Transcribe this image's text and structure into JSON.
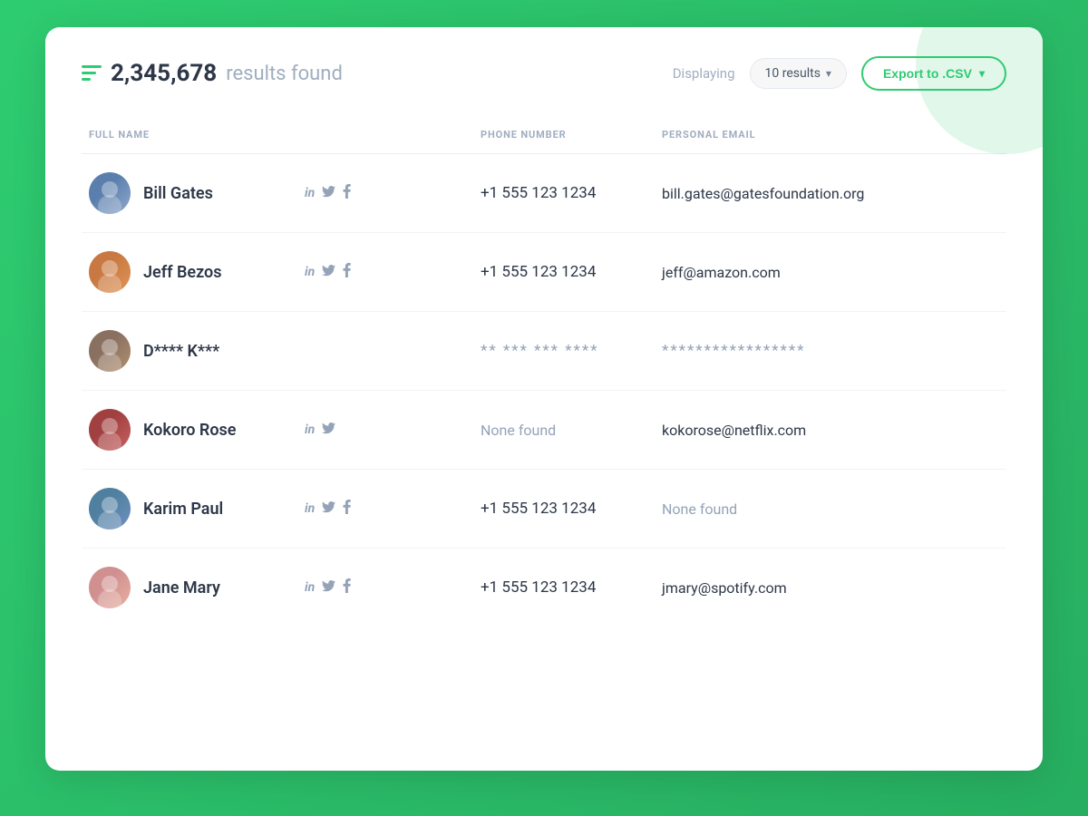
{
  "header": {
    "filter_icon": "≡",
    "results_count": "2,345,678",
    "results_label": "results found",
    "displaying_label": "Displaying",
    "results_dropdown": "10 results",
    "export_button": "Export to .CSV"
  },
  "table": {
    "columns": [
      {
        "key": "full_name",
        "label": "FULL NAME"
      },
      {
        "key": "phone_number",
        "label": "PHONE NUMBER"
      },
      {
        "key": "personal_email",
        "label": "PERSONAL EMAIL"
      }
    ],
    "rows": [
      {
        "id": "bill-gates",
        "name": "Bill Gates",
        "avatar_class": "avatar-bill",
        "avatar_emoji": "👨",
        "socials": [
          "in",
          "tw",
          "fb"
        ],
        "phone": "+1 555 123 1234",
        "phone_type": "normal",
        "email": "bill.gates@gatesfoundation.org",
        "email_type": "normal"
      },
      {
        "id": "jeff-bezos",
        "name": "Jeff Bezos",
        "avatar_class": "avatar-jeff",
        "avatar_emoji": "👨",
        "socials": [
          "in",
          "tw",
          "fb"
        ],
        "phone": "+1 555 123 1234",
        "phone_type": "normal",
        "email": "jeff@amazon.com",
        "email_type": "normal"
      },
      {
        "id": "dk",
        "name": "D**** K***",
        "avatar_class": "avatar-dk",
        "avatar_emoji": "👨",
        "socials": [],
        "phone": "** *** *** ****",
        "phone_type": "masked",
        "email": "*****************",
        "email_type": "masked"
      },
      {
        "id": "kokoro-rose",
        "name": "Kokoro Rose",
        "avatar_class": "avatar-kokoro",
        "avatar_emoji": "👩",
        "socials": [
          "in",
          "tw"
        ],
        "phone": "None found",
        "phone_type": "none",
        "email": "kokorose@netflix.com",
        "email_type": "normal"
      },
      {
        "id": "karim-paul",
        "name": "Karim Paul",
        "avatar_class": "avatar-karim",
        "avatar_emoji": "👨",
        "socials": [
          "in",
          "tw",
          "fb"
        ],
        "phone": "+1 555 123 1234",
        "phone_type": "normal",
        "email": "None found",
        "email_type": "none"
      },
      {
        "id": "jane-mary",
        "name": "Jane Mary",
        "avatar_class": "avatar-jane",
        "avatar_emoji": "👩",
        "socials": [
          "in",
          "tw",
          "fb"
        ],
        "phone": "+1 555 123 1234",
        "phone_type": "normal",
        "email": "jmary@spotify.com",
        "email_type": "normal"
      }
    ]
  },
  "social_labels": {
    "in": "in",
    "tw": "🐦",
    "fb": "f"
  }
}
